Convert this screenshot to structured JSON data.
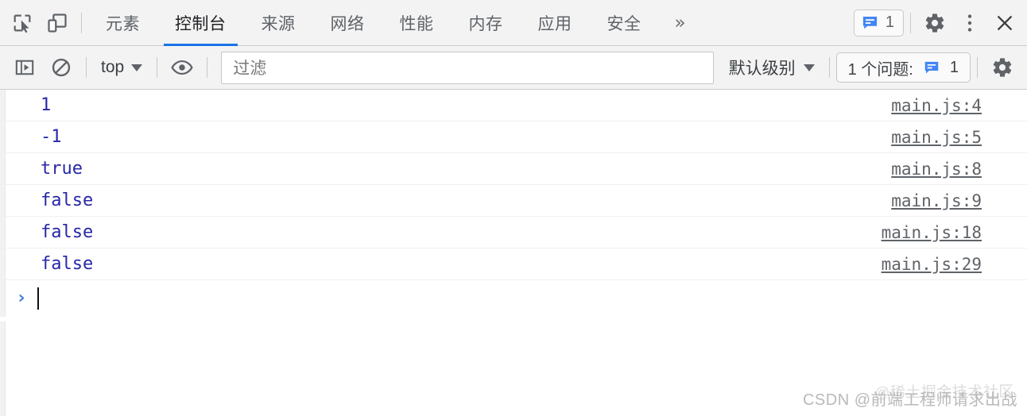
{
  "tabbar": {
    "inspect_icon": "inspect-element-icon",
    "device_icon": "device-toolbar-icon",
    "tabs": [
      {
        "label": "元素",
        "active": false
      },
      {
        "label": "控制台",
        "active": true
      },
      {
        "label": "来源",
        "active": false
      },
      {
        "label": "网络",
        "active": false
      },
      {
        "label": "性能",
        "active": false
      },
      {
        "label": "内存",
        "active": false
      },
      {
        "label": "应用",
        "active": false
      },
      {
        "label": "安全",
        "active": false
      }
    ],
    "overflow_label": "»",
    "message_badge": {
      "icon": "message-icon",
      "count": "1"
    },
    "settings_icon": "gear-icon",
    "more_icon": "more-vertical-icon",
    "close_icon": "close-icon"
  },
  "filterbar": {
    "sidebar_icon": "console-sidebar-icon",
    "clear_icon": "clear-console-icon",
    "context": {
      "label": "top"
    },
    "eye_icon": "live-expression-icon",
    "filter": {
      "placeholder": "过滤",
      "value": ""
    },
    "level": {
      "label": "默认级别"
    },
    "issues": {
      "text": "1 个问题:",
      "icon": "message-icon",
      "count": "1"
    },
    "settings_icon": "gear-icon"
  },
  "console": {
    "rows": [
      {
        "value": "1",
        "source": "main.js:4"
      },
      {
        "value": "-1",
        "source": "main.js:5"
      },
      {
        "value": "true",
        "source": "main.js:8"
      },
      {
        "value": "false",
        "source": "main.js:9"
      },
      {
        "value": "false",
        "source": "main.js:18"
      },
      {
        "value": "false",
        "source": "main.js:29"
      }
    ],
    "prompt": {
      "chevron": "›",
      "value": ""
    }
  },
  "watermarks": {
    "main": "CSDN @前端工程师请求出战",
    "ghost": "@稀土掘金技术社区"
  },
  "colors": {
    "accent": "#1a73e8",
    "value_text": "#2727a8",
    "toolbar_bg": "#f3f3f3",
    "link_text": "#5f6368"
  }
}
